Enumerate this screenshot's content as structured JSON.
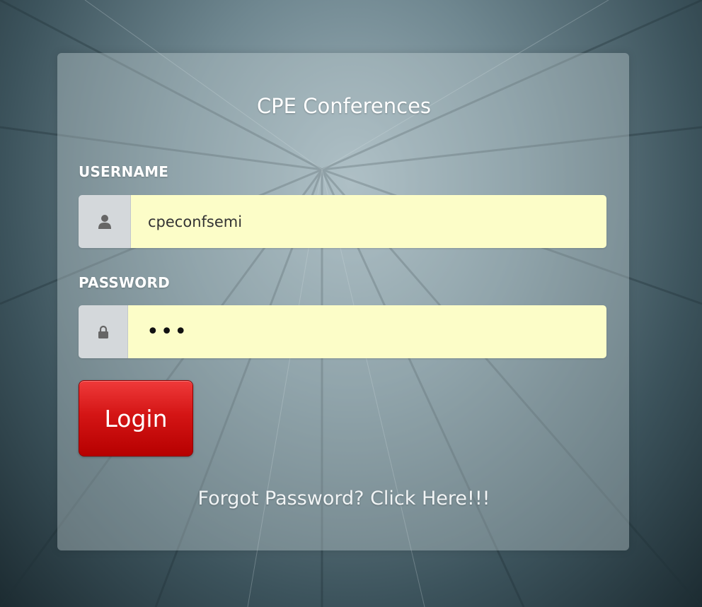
{
  "app": {
    "title": "CPE Conferences"
  },
  "form": {
    "username": {
      "label": "USERNAME",
      "value": "cpeconfsemi",
      "icon": "user-icon"
    },
    "password": {
      "label": "PASSWORD",
      "value": "•••",
      "icon": "lock-icon"
    },
    "login_label": "Login",
    "forgot_label": "Forgot Password? Click Here!!!"
  },
  "colors": {
    "input_background": "#fcfdc8",
    "login_button": "#d41515",
    "label_text": "#ffffff"
  }
}
